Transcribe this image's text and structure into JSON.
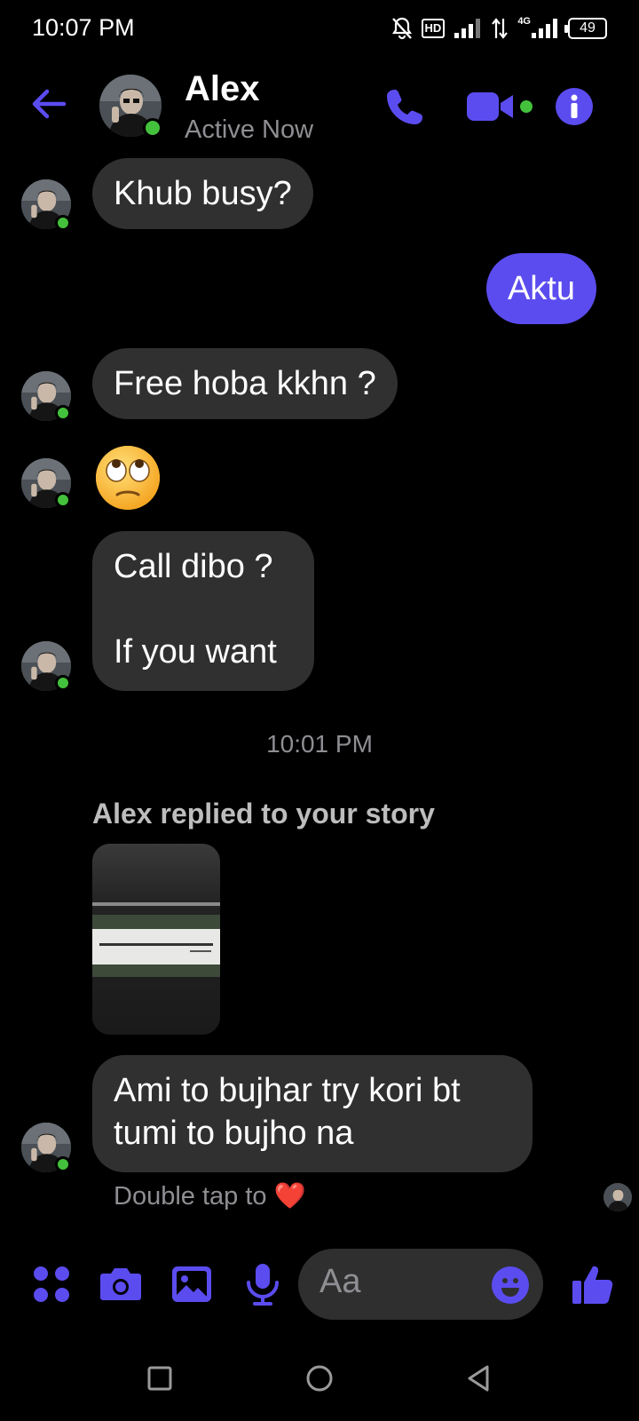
{
  "status_bar": {
    "time": "10:07 PM",
    "hd_label": "HD",
    "network_label": "4G",
    "battery": "49"
  },
  "header": {
    "contact_name": "Alex",
    "contact_status": "Active Now"
  },
  "messages": [
    {
      "text": "Khub busy?",
      "direction": "incoming"
    },
    {
      "text": "Aktu",
      "direction": "outgoing"
    },
    {
      "text": "Free hoba kkhn ?",
      "direction": "incoming"
    },
    {
      "text": "🙄",
      "direction": "incoming",
      "kind": "emoji"
    },
    {
      "text_line1": "Call dibo ?",
      "text_line2": "If you want",
      "direction": "incoming"
    },
    {
      "text_line1": "Ami to bujhar try kori bt",
      "text_line2": "tumi to bujho na",
      "direction": "incoming"
    }
  ],
  "timestamp": "10:01 PM",
  "story_reply": {
    "label": "Alex replied to your story"
  },
  "hint": {
    "text": "Double tap to",
    "heart": "❤️"
  },
  "composer": {
    "placeholder": "Aa"
  },
  "colors": {
    "accent": "#5b4cf0",
    "online": "#44c13c",
    "bubble_incoming": "#303030",
    "background": "#000000"
  },
  "icons": [
    "back-arrow-icon",
    "phone-icon",
    "video-camera-icon",
    "info-icon",
    "apps-grid-icon",
    "camera-icon",
    "gallery-icon",
    "microphone-icon",
    "emoji-icon",
    "thumbs-up-icon",
    "recent-apps-icon",
    "home-icon",
    "back-nav-icon"
  ]
}
